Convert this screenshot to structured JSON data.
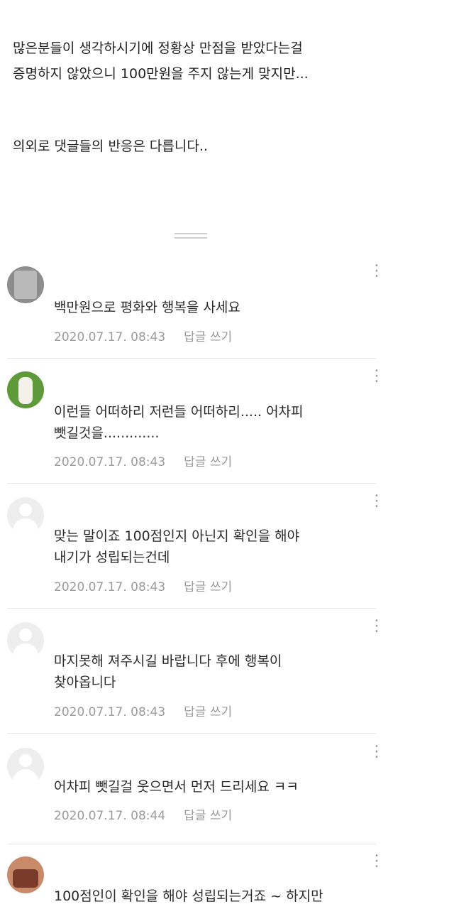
{
  "intro": {
    "line1": "많은분들이 생각하시기에 정황상 만점을 받았다는걸",
    "line2": "증명하지 않았으니 100만원을 주지 않는게 맞지만...",
    "line3": "의외로 댓글들의 반응은 다릅니다.."
  },
  "comments": [
    {
      "line1": "백만원으로 평화와 행복을 사세요",
      "line2": "",
      "time": "2020.07.17. 08:43",
      "reply": "답글 쓰기"
    },
    {
      "line1": "이런들 어떠하리 저런들 어떠하리..... 어차피",
      "line2": "뺏길것을.............",
      "time": "2020.07.17. 08:43",
      "reply": "답글 쓰기"
    },
    {
      "line1": "맞는 말이죠 100점인지 아닌지 확인을 해야",
      "line2": "내기가 성립되는건데",
      "time": "2020.07.17. 08:43",
      "reply": "답글 쓰기"
    },
    {
      "line1": "마지못해 져주시길 바랍니다 후에 행복이",
      "line2": "찾아옵니다",
      "time": "2020.07.17. 08:43",
      "reply": "답글 쓰기"
    },
    {
      "line1": "어차피 뺏길걸 웃으면서 먼저 드리세요 ㅋㅋ",
      "line2": "",
      "time": "2020.07.17. 08:44",
      "reply": "답글 쓰기"
    },
    {
      "line1": "100점인이 확인을 해야 성립되는거죠 ~ 하지만",
      "line2": "",
      "time": "",
      "reply": ""
    }
  ],
  "icons": {
    "more": "more-vertical-icon",
    "avatar_default": "default-avatar-icon"
  }
}
